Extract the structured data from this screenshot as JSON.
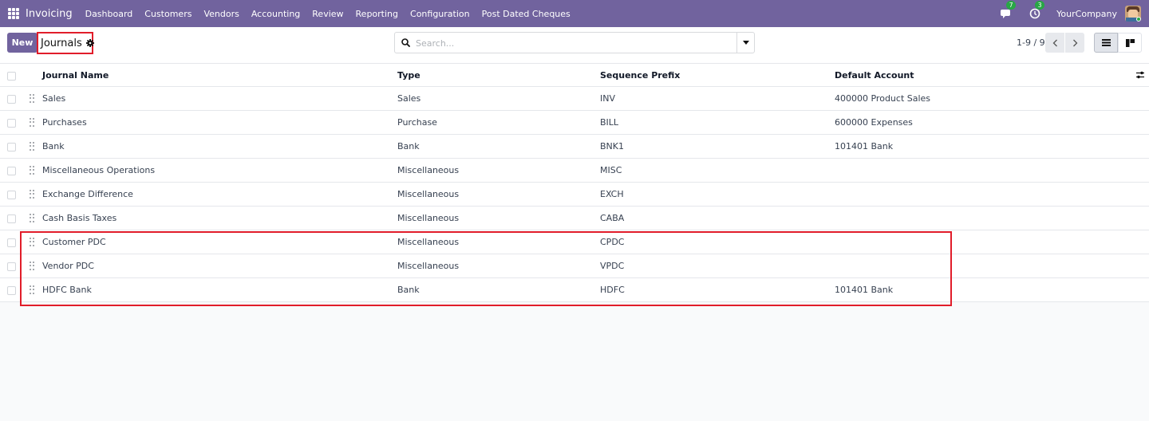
{
  "navbar": {
    "app_name": "Invoicing",
    "menu": [
      "Dashboard",
      "Customers",
      "Vendors",
      "Accounting",
      "Review",
      "Reporting",
      "Configuration",
      "Post Dated Cheques"
    ],
    "messages_count": "7",
    "activities_count": "3",
    "company": "YourCompany",
    "colors": {
      "bar": "#71639e",
      "badge": "#28a745"
    }
  },
  "control_panel": {
    "new_label": "New",
    "breadcrumb": "Journals",
    "search_placeholder": "Search...",
    "pager": "1-9 / 9"
  },
  "table": {
    "headers": {
      "name": "Journal Name",
      "type": "Type",
      "sequence_prefix": "Sequence Prefix",
      "default_account": "Default Account"
    },
    "rows": [
      {
        "name": "Sales",
        "type": "Sales",
        "prefix": "INV",
        "account": "400000 Product Sales"
      },
      {
        "name": "Purchases",
        "type": "Purchase",
        "prefix": "BILL",
        "account": "600000 Expenses"
      },
      {
        "name": "Bank",
        "type": "Bank",
        "prefix": "BNK1",
        "account": "101401 Bank"
      },
      {
        "name": "Miscellaneous Operations",
        "type": "Miscellaneous",
        "prefix": "MISC",
        "account": ""
      },
      {
        "name": "Exchange Difference",
        "type": "Miscellaneous",
        "prefix": "EXCH",
        "account": ""
      },
      {
        "name": "Cash Basis Taxes",
        "type": "Miscellaneous",
        "prefix": "CABA",
        "account": ""
      },
      {
        "name": "Customer PDC",
        "type": "Miscellaneous",
        "prefix": "CPDC",
        "account": ""
      },
      {
        "name": "Vendor PDC",
        "type": "Miscellaneous",
        "prefix": "VPDC",
        "account": ""
      },
      {
        "name": "HDFC Bank",
        "type": "Bank",
        "prefix": "HDFC",
        "account": "101401 Bank"
      }
    ]
  },
  "annotation_color": "#e11d2a"
}
